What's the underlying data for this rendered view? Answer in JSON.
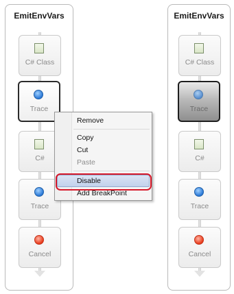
{
  "left_panel": {
    "title": "EmitEnvVars",
    "nodes": [
      {
        "label": "C# Class",
        "icon": "code-file-icon"
      },
      {
        "label": "Trace",
        "icon": "info-icon",
        "selected": true
      },
      {
        "label": "C#",
        "icon": "code-file-icon"
      },
      {
        "label": "Trace",
        "icon": "info-icon"
      },
      {
        "label": "Cancel",
        "icon": "stop-icon"
      }
    ]
  },
  "context_menu": {
    "items": [
      {
        "label": "Remove",
        "enabled": true
      },
      {
        "label": "Copy",
        "enabled": true
      },
      {
        "label": "Cut",
        "enabled": true
      },
      {
        "label": "Paste",
        "enabled": false
      },
      {
        "label": "Disable",
        "enabled": true,
        "highlighted": true
      },
      {
        "label": "Add BreakPoint",
        "enabled": true
      }
    ]
  },
  "right_panel": {
    "title": "EmitEnvVars",
    "nodes": [
      {
        "label": "C# Class",
        "icon": "code-file-icon"
      },
      {
        "label": "Trace",
        "icon": "info-icon",
        "disabled_appearance": true
      },
      {
        "label": "C#",
        "icon": "code-file-icon"
      },
      {
        "label": "Trace",
        "icon": "info-icon"
      },
      {
        "label": "Cancel",
        "icon": "stop-icon"
      }
    ]
  },
  "colors": {
    "highlight_outline": "#d6182a",
    "menu_highlight": "#c2d2ec"
  }
}
